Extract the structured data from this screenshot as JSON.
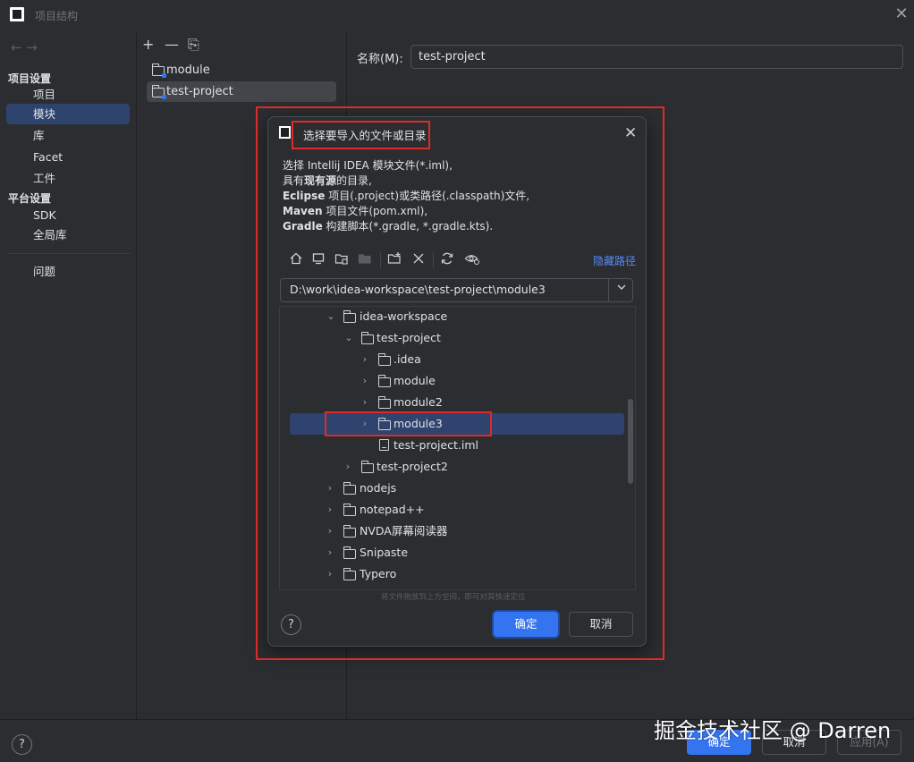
{
  "window": {
    "title": "项目结构",
    "close_glyph": "✕"
  },
  "nav": {
    "back_forward": "←  →",
    "section_project": "项目设置",
    "items_project": [
      "项目",
      "模块",
      "库",
      "Facet",
      "工件"
    ],
    "section_platform": "平台设置",
    "items_platform": [
      "SDK",
      "全局库"
    ],
    "problems": "问题",
    "selected": "模块"
  },
  "modules": {
    "toolbar": {
      "add": "+",
      "remove": "—",
      "copy": "⎘"
    },
    "items": [
      "module",
      "test-project"
    ],
    "selected": "test-project"
  },
  "detail": {
    "name_label": "名称(M):",
    "name_value": "test-project"
  },
  "footer": {
    "help": "?",
    "ok": "确定",
    "cancel": "取消",
    "apply": "应用(A)",
    "watermark": "掘金技术社区 @ Darren"
  },
  "dialog": {
    "title": "选择要导入的文件或目录",
    "close_glyph": "✕",
    "desc_1": "选择 Intellij IDEA 模块文件(*.iml),",
    "desc_2_a": "具有",
    "desc_2_b": "现有源",
    "desc_2_c": "的目录,",
    "desc_3_a": "Eclipse",
    "desc_3_b": " 项目(.project)或类路径(.classpath)文件,",
    "desc_4_a": "Maven",
    "desc_4_b": " 项目文件(pom.xml),",
    "desc_5_a": "Gradle",
    "desc_5_b": " 构建脚本(*.gradle, *.gradle.kts).",
    "hide_path": "隐藏路径",
    "path": "D:\\work\\idea-workspace\\test-project\\module3",
    "tree": [
      {
        "label": "idea-workspace",
        "expanded": true,
        "type": "folder"
      },
      {
        "label": "test-project",
        "expanded": true,
        "type": "folder"
      },
      {
        "label": ".idea",
        "expanded": false,
        "type": "folder"
      },
      {
        "label": "module",
        "expanded": false,
        "type": "folder"
      },
      {
        "label": "module2",
        "expanded": false,
        "type": "folder"
      },
      {
        "label": "module3",
        "expanded": false,
        "type": "folder",
        "selected": true
      },
      {
        "label": "test-project.iml",
        "type": "file"
      },
      {
        "label": "test-project2",
        "expanded": false,
        "type": "folder"
      },
      {
        "label": "nodejs",
        "expanded": false,
        "type": "folder"
      },
      {
        "label": "notepad++",
        "expanded": false,
        "type": "folder"
      },
      {
        "label": "NVDA屏幕阅读器",
        "expanded": false,
        "type": "folder"
      },
      {
        "label": "Snipaste",
        "expanded": false,
        "type": "folder"
      },
      {
        "label": "Typero",
        "expanded": false,
        "type": "folder"
      }
    ],
    "drop_hint": "将文件拖放到上方空间，即可对其快速定位",
    "help": "?",
    "ok": "确定",
    "cancel": "取消"
  },
  "colors": {
    "accent": "#3574f0",
    "selection": "#2e436e",
    "highlight": "#e02a2a",
    "background": "#2b2d30"
  }
}
